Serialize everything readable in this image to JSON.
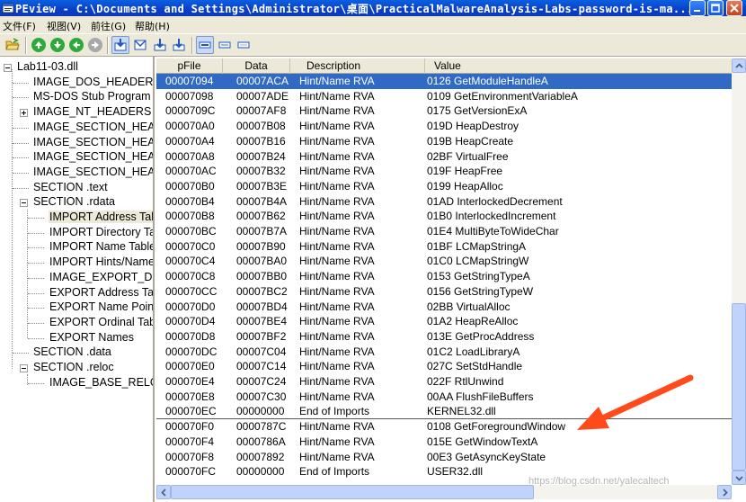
{
  "window": {
    "title": "PEview - C:\\Documents and Settings\\Administrator\\桌面\\PracticalMalwareAnalysis-Labs-password-is-ma..."
  },
  "menu": {
    "items": [
      "文件(F)",
      "视图(V)",
      "前往(G)",
      "帮助(H)"
    ]
  },
  "colors": {
    "selection": "#316ac5",
    "arrow": "#ff4a1a",
    "chrome": "#ece9d8"
  },
  "tree": {
    "items": [
      "Lab11-03.dll",
      "IMAGE_DOS_HEADER",
      "MS-DOS Stub Program",
      "IMAGE_NT_HEADERS",
      "IMAGE_SECTION_HEAI",
      "IMAGE_SECTION_HEAI",
      "IMAGE_SECTION_HEAI",
      "IMAGE_SECTION_HEAI",
      "SECTION .text",
      "SECTION .rdata",
      "IMPORT Address Tab",
      "IMPORT Directory Ta",
      "IMPORT Name Table",
      "IMPORT Hints/Name",
      "IMAGE_EXPORT_DIF",
      "EXPORT Address Ta",
      "EXPORT Name Point",
      "EXPORT Ordinal Tab",
      "EXPORT Names",
      "SECTION .data",
      "SECTION .reloc",
      "IMAGE_BASE_RELO"
    ]
  },
  "table": {
    "columns": [
      "pFile",
      "Data",
      "Description",
      "Value"
    ],
    "rows": [
      [
        "00007094",
        "00007ACA",
        "Hint/Name RVA",
        "0126  GetModuleHandleA"
      ],
      [
        "00007098",
        "00007ADE",
        "Hint/Name RVA",
        "0109  GetEnvironmentVariableA"
      ],
      [
        "0000709C",
        "00007AF8",
        "Hint/Name RVA",
        "0175  GetVersionExA"
      ],
      [
        "000070A0",
        "00007B08",
        "Hint/Name RVA",
        "019D  HeapDestroy"
      ],
      [
        "000070A4",
        "00007B16",
        "Hint/Name RVA",
        "019B  HeapCreate"
      ],
      [
        "000070A8",
        "00007B24",
        "Hint/Name RVA",
        "02BF  VirtualFree"
      ],
      [
        "000070AC",
        "00007B32",
        "Hint/Name RVA",
        "019F  HeapFree"
      ],
      [
        "000070B0",
        "00007B3E",
        "Hint/Name RVA",
        "0199  HeapAlloc"
      ],
      [
        "000070B4",
        "00007B4A",
        "Hint/Name RVA",
        "01AD  InterlockedDecrement"
      ],
      [
        "000070B8",
        "00007B62",
        "Hint/Name RVA",
        "01B0  InterlockedIncrement"
      ],
      [
        "000070BC",
        "00007B7A",
        "Hint/Name RVA",
        "01E4  MultiByteToWideChar"
      ],
      [
        "000070C0",
        "00007B90",
        "Hint/Name RVA",
        "01BF  LCMapStringA"
      ],
      [
        "000070C4",
        "00007BA0",
        "Hint/Name RVA",
        "01C0  LCMapStringW"
      ],
      [
        "000070C8",
        "00007BB0",
        "Hint/Name RVA",
        "0153  GetStringTypeA"
      ],
      [
        "000070CC",
        "00007BC2",
        "Hint/Name RVA",
        "0156  GetStringTypeW"
      ],
      [
        "000070D0",
        "00007BD4",
        "Hint/Name RVA",
        "02BB  VirtualAlloc"
      ],
      [
        "000070D4",
        "00007BE4",
        "Hint/Name RVA",
        "01A2  HeapReAlloc"
      ],
      [
        "000070D8",
        "00007BF2",
        "Hint/Name RVA",
        "013E  GetProcAddress"
      ],
      [
        "000070DC",
        "00007C04",
        "Hint/Name RVA",
        "01C2  LoadLibraryA"
      ],
      [
        "000070E0",
        "00007C14",
        "Hint/Name RVA",
        "027C  SetStdHandle"
      ],
      [
        "000070E4",
        "00007C24",
        "Hint/Name RVA",
        "022F  RtlUnwind"
      ],
      [
        "000070E8",
        "00007C30",
        "Hint/Name RVA",
        "00AA  FlushFileBuffers"
      ],
      [
        "000070EC",
        "00000000",
        "End of Imports",
        "KERNEL32.dll"
      ],
      [
        "000070F0",
        "0000787C",
        "Hint/Name RVA",
        "0108  GetForegroundWindow"
      ],
      [
        "000070F4",
        "0000786A",
        "Hint/Name RVA",
        "015E  GetWindowTextA"
      ],
      [
        "000070F8",
        "00007892",
        "Hint/Name RVA",
        "00E3  GetAsyncKeyState"
      ],
      [
        "000070FC",
        "00000000",
        "End of Imports",
        "USER32.dll"
      ]
    ]
  },
  "watermark": "https://blog.csdn.net/yalecaltech"
}
